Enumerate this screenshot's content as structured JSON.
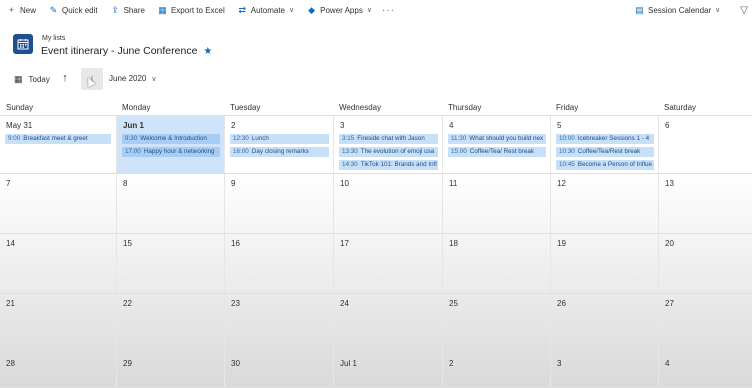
{
  "commands": {
    "new": "New",
    "quick_edit": "Quick edit",
    "share": "Share",
    "export_excel": "Export to Excel",
    "automate": "Automate",
    "power_apps": "Power Apps",
    "more": "···",
    "view_selector": "Session Calendar"
  },
  "header": {
    "breadcrumb": "My lists",
    "title": "Event itinerary - June Conference"
  },
  "toolbar": {
    "today": "Today",
    "month": "June 2020"
  },
  "weekdays": [
    "Sunday",
    "Monday",
    "Tuesday",
    "Wednesday",
    "Thursday",
    "Friday",
    "Saturday"
  ],
  "weeks": [
    {
      "days": [
        {
          "label": "May 31",
          "today": false,
          "events": [
            {
              "time": "9:00",
              "title": "Breakfast meet & greet"
            }
          ]
        },
        {
          "label": "Jun 1",
          "today": true,
          "events": [
            {
              "time": "9:30",
              "title": "Welcome & Introduction"
            },
            {
              "time": "17:00",
              "title": "Happy hour & networking"
            }
          ]
        },
        {
          "label": "2",
          "today": false,
          "events": [
            {
              "time": "12:30",
              "title": "Lunch"
            },
            {
              "time": "16:00",
              "title": "Day closing remarks"
            }
          ]
        },
        {
          "label": "3",
          "today": false,
          "events": [
            {
              "time": "3:15",
              "title": "Fireside chat with Jason"
            },
            {
              "time": "13:30",
              "title": "The evolution of emoji usa"
            },
            {
              "time": "14:30",
              "title": "TikTok 101: Brands and Infl"
            }
          ]
        },
        {
          "label": "4",
          "today": false,
          "events": [
            {
              "time": "11:30",
              "title": "What should you build nex"
            },
            {
              "time": "15:00",
              "title": "Coffee/Tea/ Rest break"
            }
          ]
        },
        {
          "label": "5",
          "today": false,
          "events": [
            {
              "time": "10:00",
              "title": "Icebreaker Sessions 1 - 4"
            },
            {
              "time": "10:30",
              "title": "Coffee/Tea/Rest break"
            },
            {
              "time": "10:45",
              "title": "Become a Person of Influe"
            }
          ]
        },
        {
          "label": "6",
          "today": false,
          "events": []
        }
      ]
    },
    {
      "days": [
        {
          "label": "7",
          "events": []
        },
        {
          "label": "8",
          "events": []
        },
        {
          "label": "9",
          "events": []
        },
        {
          "label": "10",
          "events": []
        },
        {
          "label": "11",
          "events": []
        },
        {
          "label": "12",
          "events": []
        },
        {
          "label": "13",
          "events": []
        }
      ]
    },
    {
      "days": [
        {
          "label": "14",
          "events": []
        },
        {
          "label": "15",
          "events": []
        },
        {
          "label": "16",
          "events": []
        },
        {
          "label": "17",
          "events": []
        },
        {
          "label": "18",
          "events": []
        },
        {
          "label": "19",
          "events": []
        },
        {
          "label": "20",
          "events": []
        }
      ]
    },
    {
      "days": [
        {
          "label": "21",
          "events": []
        },
        {
          "label": "22",
          "events": []
        },
        {
          "label": "23",
          "events": []
        },
        {
          "label": "24",
          "events": []
        },
        {
          "label": "25",
          "events": []
        },
        {
          "label": "26",
          "events": []
        },
        {
          "label": "27",
          "events": []
        }
      ]
    },
    {
      "days": [
        {
          "label": "28",
          "events": []
        },
        {
          "label": "29",
          "events": []
        },
        {
          "label": "30",
          "events": []
        },
        {
          "label": "Jul 1",
          "events": []
        },
        {
          "label": "2",
          "events": []
        },
        {
          "label": "3",
          "events": []
        },
        {
          "label": "4",
          "events": []
        }
      ]
    }
  ],
  "colors": {
    "accent": "#0f6cbd",
    "today_bg": "#cfe4fa",
    "event_bg": "#c7dff7",
    "event_text": "#1b4f8a"
  },
  "icons": {
    "new": "plus-icon",
    "quick_edit": "pencil-icon",
    "share": "share-icon",
    "export_excel": "excel-icon",
    "automate": "flow-icon",
    "power_apps": "power-apps-icon",
    "view": "calendar-view-icon",
    "filter": "filter-icon",
    "list": "calendar-list-icon",
    "favorite": "star-icon",
    "today": "calendar-today-icon",
    "prev": "arrow-up-icon",
    "next": "arrow-down-icon"
  }
}
